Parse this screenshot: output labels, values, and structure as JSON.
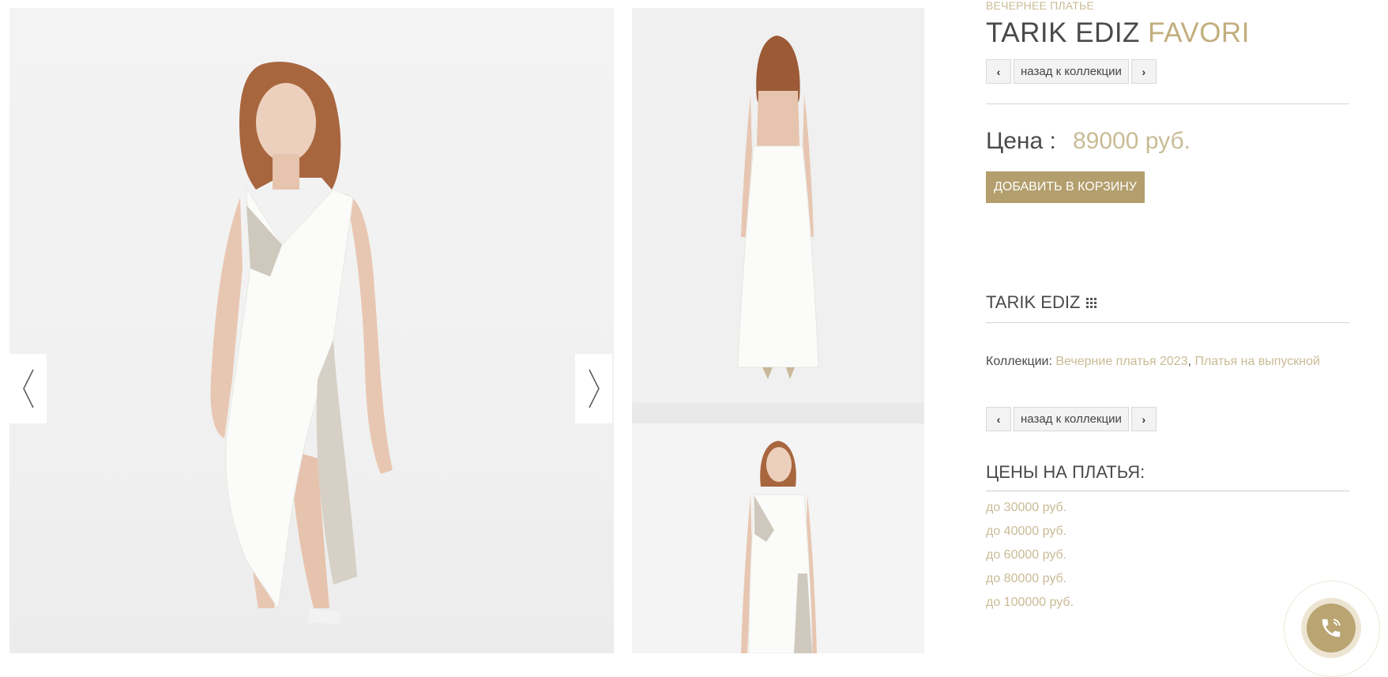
{
  "product": {
    "category": "ВЕЧЕРНЕЕ ПЛАТЬЕ",
    "brand_title": "TARIK EDIZ",
    "model_title": "FAVORI",
    "price_label": "Цена :",
    "price_value": "89000 руб.",
    "add_to_cart_label": "ДОБАВИТЬ В КОРЗИНУ"
  },
  "nav": {
    "back_label": "назад к коллекции",
    "prev_icon": "chevron-left-icon",
    "next_icon": "chevron-right-icon"
  },
  "brand_block": {
    "name": "TARIK EDIZ",
    "icon": "grid-icon"
  },
  "collections": {
    "label": "Коллекции:",
    "links": [
      "Вечерние платья 2023",
      "Платья на выпускной"
    ],
    "separator": ", "
  },
  "prices_section": {
    "heading": "ЦЕНЫ НА ПЛАТЬЯ:",
    "items": [
      "до 30000 руб.",
      "до 40000 руб.",
      "до 60000 руб.",
      "до 80000 руб.",
      "до 100000 руб."
    ]
  },
  "gallery": {
    "prev_icon": "angle-left-icon",
    "next_icon": "angle-right-icon"
  },
  "call_widget": {
    "icon": "phone-icon"
  },
  "colors": {
    "accent": "#c9bb95",
    "button": "#b39e6d",
    "text": "#4a4a4a"
  }
}
